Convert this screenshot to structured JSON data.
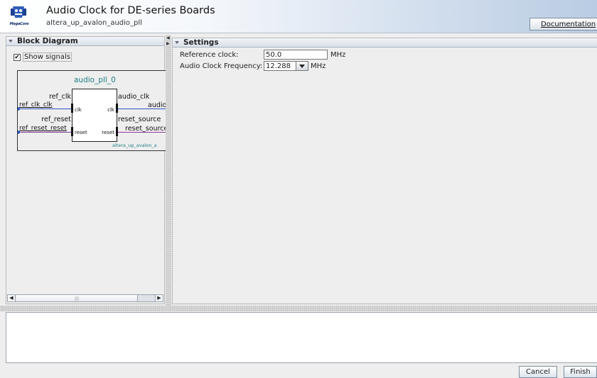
{
  "header": {
    "title": "Audio Clock for DE-series Boards",
    "subtitle": "altera_up_avalon_audio_pll",
    "logo_text": "MegaCore",
    "documentation_button": "Documentation"
  },
  "block_diagram": {
    "heading": "Block Diagram",
    "show_signals_label": "Show signals",
    "show_signals_checked": true,
    "instance_name": "audio_pll_0",
    "left_ports": [
      {
        "interface": "ref_clk",
        "export": "ref_clk_clk",
        "signal": "clk"
      },
      {
        "interface": "ref_reset",
        "export": "ref_reset_reset",
        "signal": "reset"
      }
    ],
    "right_ports": [
      {
        "interface": "audio_clk",
        "signal": "clk",
        "export": "audio"
      },
      {
        "interface": "reset_source",
        "signal": "reset",
        "export": "reset_source"
      }
    ],
    "component_type": "altera_up_avalon_a"
  },
  "settings": {
    "heading": "Settings",
    "reference_clock_label": "Reference clock:",
    "reference_clock_value": "50.0",
    "reference_clock_unit": "MHz",
    "audio_freq_label": "Audio Clock Frequency:",
    "audio_freq_value": "12.288",
    "audio_freq_unit": "MHz"
  },
  "footer": {
    "cancel_button": "Cancel",
    "finish_button": "Finish"
  },
  "colors": {
    "teal_text": "#1f7f80",
    "clock_wire": "#2a55c9",
    "reset_wire": "#8a3a9c"
  }
}
